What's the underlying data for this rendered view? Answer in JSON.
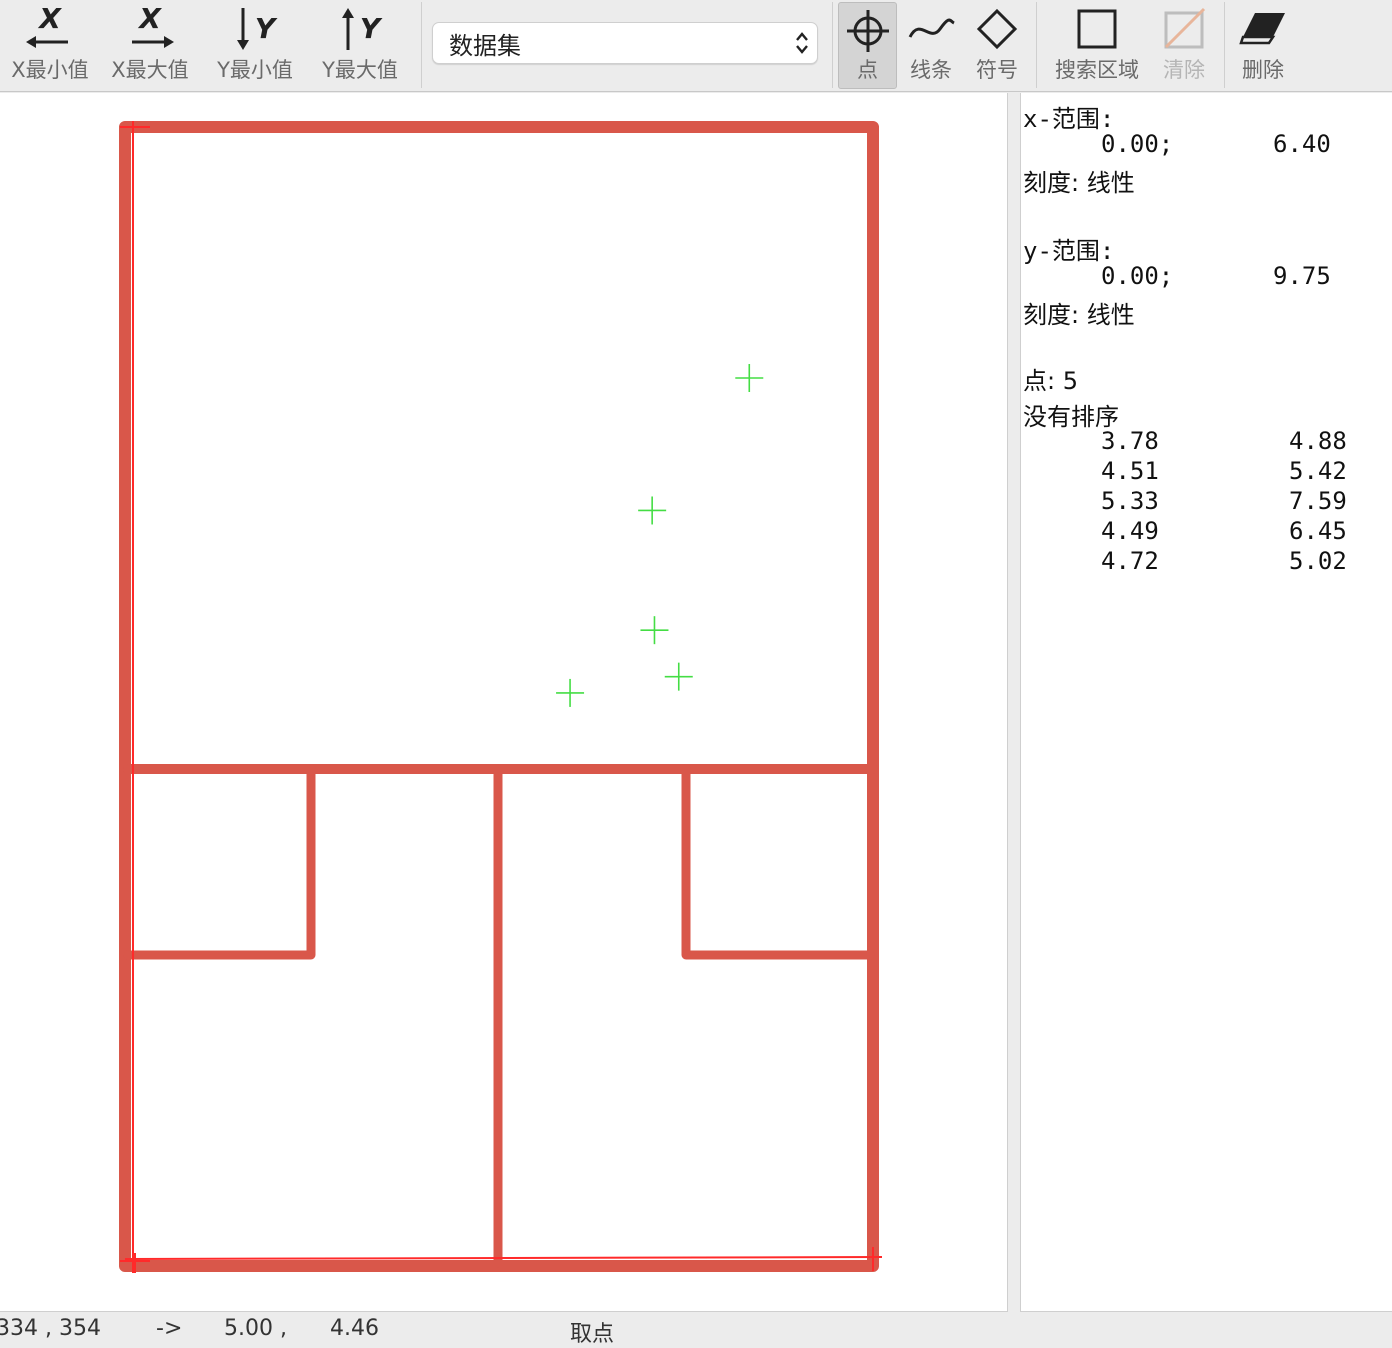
{
  "toolbar": {
    "x_min": {
      "axis": "X",
      "label": "X最小值"
    },
    "x_max": {
      "axis": "X",
      "label": "X最大值"
    },
    "y_min": {
      "axis": "Y",
      "label": "Y最小值"
    },
    "y_max": {
      "axis": "Y",
      "label": "Y最大值"
    },
    "dataset": {
      "value": "数据集"
    },
    "point": {
      "label": "点"
    },
    "line": {
      "label": "线条"
    },
    "symbol": {
      "label": "符号"
    },
    "search_area": {
      "label": "搜索区域"
    },
    "clear": {
      "label": "清除"
    },
    "delete": {
      "label": "删除"
    }
  },
  "info": {
    "x_range_title": "x-范围:",
    "x_min": "0.00;",
    "x_max": "6.40",
    "x_scale": "刻度: 线性",
    "y_range_title": "y-范围:",
    "y_min": "0.00;",
    "y_max": "9.75",
    "y_scale": "刻度: 线性",
    "points_count": "点: 5",
    "sort": "没有排序",
    "points": [
      {
        "x": "3.78",
        "y": "4.88"
      },
      {
        "x": "4.51",
        "y": "5.42"
      },
      {
        "x": "5.33",
        "y": "7.59"
      },
      {
        "x": "4.49",
        "y": "6.45"
      },
      {
        "x": "4.72",
        "y": "5.02"
      }
    ]
  },
  "status": {
    "pixel": "334 , 354",
    "arrow": "->",
    "x_val": "5.00 ,",
    "y_val": "4.46",
    "mode": "取点"
  },
  "colors": {
    "wall": "#d9574a",
    "marker": "#44dd44",
    "calib": "#ff2a2a"
  }
}
